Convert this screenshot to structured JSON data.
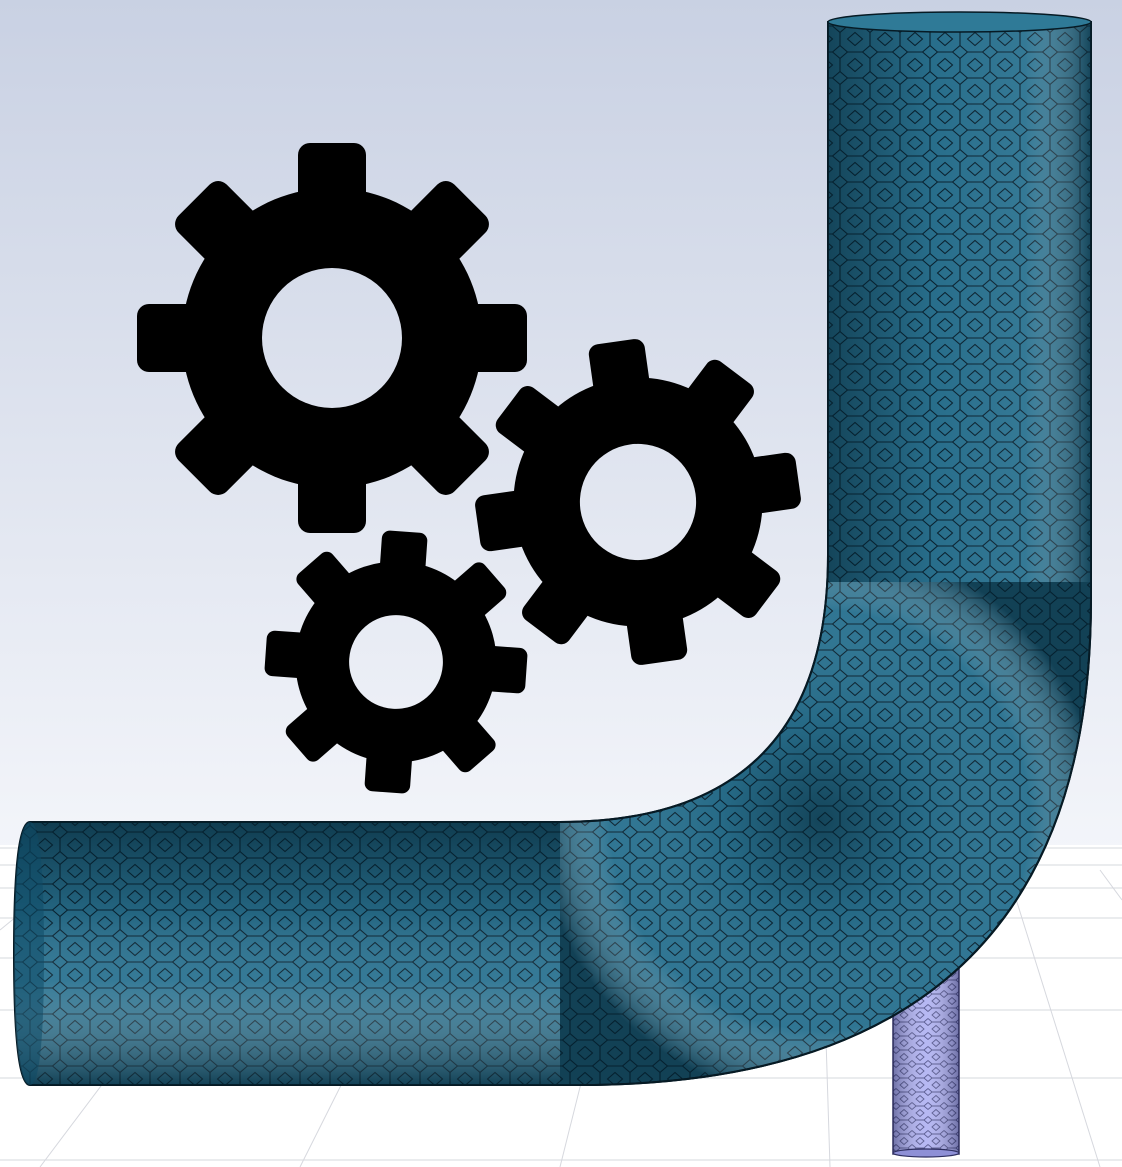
{
  "scene": {
    "colors": {
      "sky_top": "#c9d1e3",
      "sky_bottom": "#f3f5fa",
      "floor": "#ffffff",
      "grid_line": "#d6d8de",
      "pipe_mesh_dark": "#0b3f5a",
      "pipe_mesh_mid": "#2a7290",
      "pipe_mesh_light": "#3a86a3",
      "mesh_edge": "#0a2230",
      "branch_mesh": "#aeb0f2",
      "branch_edge": "#4a4c86",
      "gear_fill": "#000000"
    },
    "icons": [
      "gear-large-icon",
      "gear-medium-icon",
      "gear-small-icon"
    ],
    "objects": [
      "elbow-pipe-mesh",
      "branch-pipe-mesh",
      "floor-grid"
    ]
  }
}
